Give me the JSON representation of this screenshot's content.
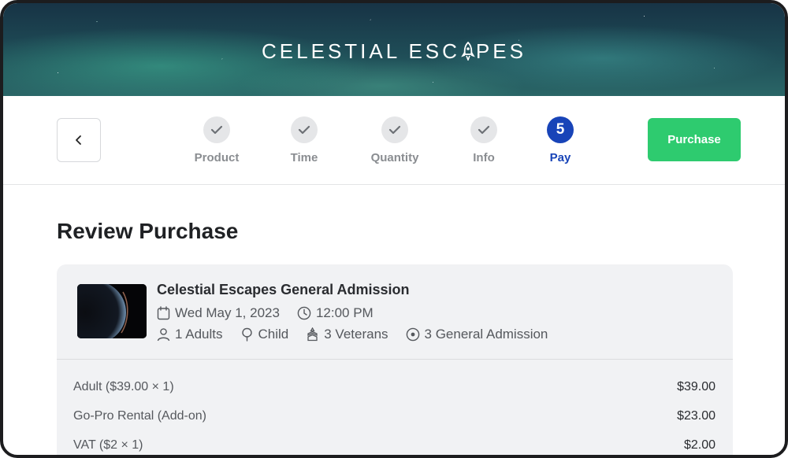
{
  "brand": {
    "logo_text_before": "CELESTIAL ESC",
    "logo_text_after": "PES",
    "logo_icon": "rocket-icon"
  },
  "nav": {
    "back_icon": "chevron-left-icon",
    "purchase_label": "Purchase"
  },
  "steps": [
    {
      "label": "Product",
      "state": "done"
    },
    {
      "label": "Time",
      "state": "done"
    },
    {
      "label": "Quantity",
      "state": "done"
    },
    {
      "label": "Info",
      "state": "done"
    },
    {
      "label": "Pay",
      "state": "active",
      "number": "5"
    }
  ],
  "page": {
    "title": "Review Purchase"
  },
  "order": {
    "product_name": "Celestial Escapes General Admission",
    "date": "Wed May 1, 2023",
    "time": "12:00 PM",
    "tickets": [
      {
        "icon": "user-icon",
        "text": "1 Adults"
      },
      {
        "icon": "child-icon",
        "text": "Child"
      },
      {
        "icon": "veteran-badge-icon",
        "text": "3 Veterans"
      },
      {
        "icon": "general-admission-icon",
        "text": "3 General Admission"
      }
    ],
    "line_items": [
      {
        "label": "Adult ($39.00 × 1)",
        "amount": "$39.00"
      },
      {
        "label": "Go-Pro Rental (Add-on)",
        "amount": "$23.00"
      },
      {
        "label": "VAT ($2 × 1)",
        "amount": "$2.00"
      }
    ]
  },
  "colors": {
    "accent": "#1844b8",
    "purchase": "#2ecb6f"
  }
}
